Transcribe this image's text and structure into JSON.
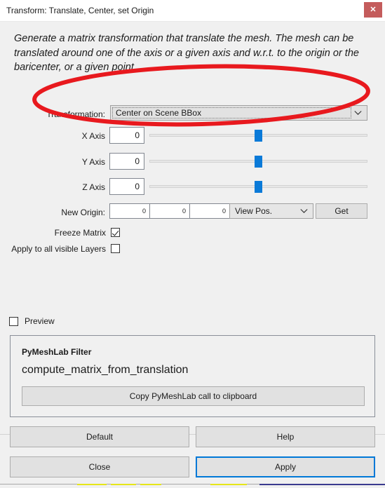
{
  "window": {
    "title": "Transform: Translate, Center, set Origin",
    "close_label": "✕"
  },
  "description": "Generate a matrix transformation that translate the mesh. The mesh can be translated around one of the axis or a given axis and w.r.t. to the origin or the baricenter, or a given point.",
  "form": {
    "transformation": {
      "label": "Transformation:",
      "value": "Center on Scene BBox"
    },
    "axes": [
      {
        "label": "X Axis",
        "value": "0",
        "slider_percent": 50
      },
      {
        "label": "Y Axis",
        "value": "0",
        "slider_percent": 50
      },
      {
        "label": "Z Axis",
        "value": "0",
        "slider_percent": 50
      }
    ],
    "new_origin": {
      "label": "New Origin:",
      "x": "0",
      "y": "0",
      "z": "0",
      "mode": "View Pos.",
      "get_label": "Get"
    },
    "freeze_matrix": {
      "label": "Freeze Matrix",
      "checked": true
    },
    "apply_all_layers": {
      "label": "Apply to all visible Layers",
      "checked": false
    }
  },
  "preview": {
    "label": "Preview",
    "checked": false
  },
  "pymeshlab_panel": {
    "title": "PyMeshLab Filter",
    "filter_name": "compute_matrix_from_translation",
    "copy_label": "Copy PyMeshLab call to clipboard"
  },
  "buttons": {
    "default": "Default",
    "help": "Help",
    "close": "Close",
    "apply": "Apply"
  },
  "colors": {
    "accent": "#0078d7",
    "slider_handle": "#0a7ad8",
    "close_button": "#c45c5c",
    "annotation": "#e8191e",
    "dialog_bg": "#f0f0f0"
  }
}
